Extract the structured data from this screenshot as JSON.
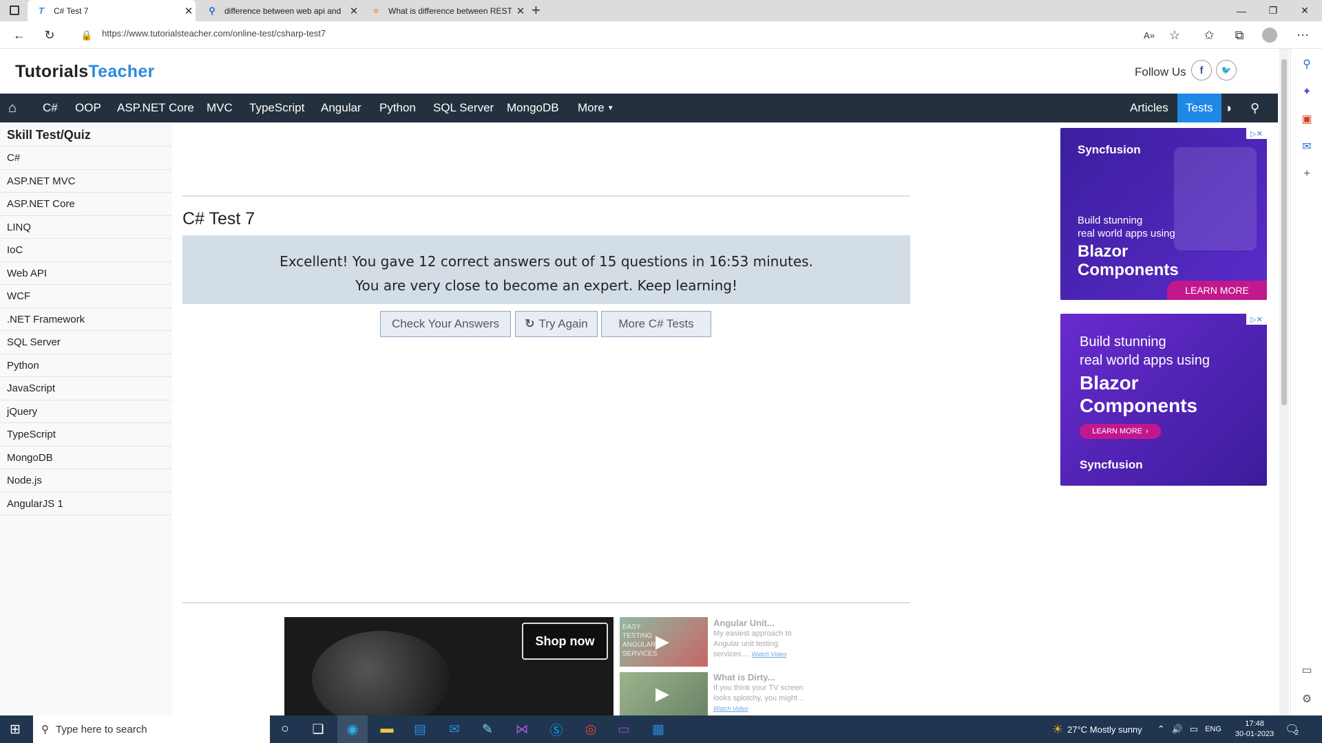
{
  "browser": {
    "tabs": [
      {
        "title": "C# Test 7",
        "icon": "tutorialsteacher-favicon"
      },
      {
        "title": "difference between web api and",
        "icon": "search-favicon"
      },
      {
        "title": "What is difference between REST",
        "icon": "stackoverflow-favicon"
      }
    ],
    "url": "https://www.tutorialsteacher.com/online-test/csharp-test7"
  },
  "site": {
    "logo_part1": "Tutorials",
    "logo_part2": "Teacher",
    "follow_label": "Follow Us",
    "nav": [
      "C#",
      "OOP",
      "ASP.NET Core",
      "MVC",
      "TypeScript",
      "Angular",
      "Python",
      "SQL Server",
      "MongoDB",
      "More"
    ],
    "nav_right": [
      "Articles",
      "Tests"
    ],
    "accent": "#1e88e5",
    "nav_bg": "#25303f"
  },
  "sidebar": {
    "title": "Skill Test/Quiz",
    "items": [
      "C#",
      "ASP.NET MVC",
      "ASP.NET Core",
      "LINQ",
      "IoC",
      "Web API",
      "WCF",
      ".NET Framework",
      "SQL Server",
      "Python",
      "JavaScript",
      "jQuery",
      "TypeScript",
      "MongoDB",
      "Node.js",
      "AngularJS 1"
    ]
  },
  "main": {
    "title": "C# Test 7",
    "result_line1": "Excellent! You gave 12 correct answers out of 15 questions in 16:53 minutes.",
    "result_line2": "You are very close to become an expert. Keep learning!",
    "buttons": {
      "check": "Check Your Answers",
      "retry": "Try Again",
      "more": "More C# Tests"
    }
  },
  "ads": {
    "ad1": {
      "brand": "Syncfusion",
      "line1": "Build stunning",
      "line2": "real world apps using",
      "line3": "Blazor",
      "line4": "Components",
      "cta": "LEARN MORE"
    },
    "ad2": {
      "brand": "Syncfusion",
      "line1": "Build stunning",
      "line2": "real world apps using",
      "line3": "Blazor",
      "line4": "Components",
      "cta": "LEARN MORE"
    }
  },
  "video": {
    "shop": "Shop now",
    "thumb1_text": "EASY TESTING ANGULAR SERVICES",
    "items": [
      {
        "title": "Angular Unit...",
        "desc": "My easiest approach to Angular unit testing services....",
        "link": "Watch Video"
      },
      {
        "title": "What is Dirty...",
        "desc": "If you think your TV screen looks splotchy, you might...",
        "link": "Watch Video"
      }
    ]
  },
  "taskbar": {
    "search_placeholder": "Type here to search",
    "weather": "27°C  Mostly sunny",
    "lang": "ENG",
    "time": "17:48",
    "date": "30-01-2023",
    "notif_count": "2"
  }
}
